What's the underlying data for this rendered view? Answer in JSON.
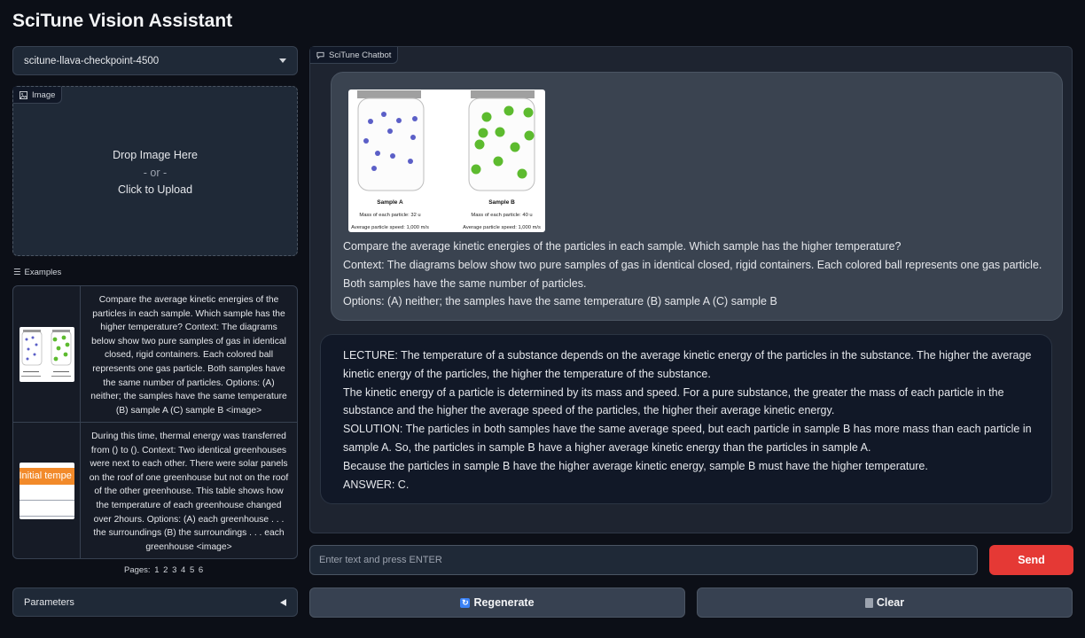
{
  "app": {
    "title": "SciTune Vision Assistant"
  },
  "model_select": {
    "value": "scitune-llava-checkpoint-4500",
    "icon": "chevron-down-icon"
  },
  "image_upload": {
    "label": "Image",
    "drop_text": "Drop Image Here",
    "or_text": "- or -",
    "click_text": "Click to Upload"
  },
  "examples": {
    "label": "Examples",
    "rows": [
      {
        "text": "Compare the average kinetic energies of the particles in each sample. Which sample has the higher temperature? Context: The diagrams below show two pure samples of gas in identical closed, rigid containers. Each colored ball represents one gas particle. Both samples have the same number of particles. Options: (A) neither; the samples have the same temperature (B) sample A (C) sample B <image>"
      },
      {
        "text": "During this time, thermal energy was transferred from () to (). Context: Two identical greenhouses were next to each other. There were solar panels on the roof of one greenhouse but not on the roof of the other greenhouse. This table shows how the temperature of each greenhouse changed over 2hours. Options: (A) each greenhouse . . . the surroundings (B) the surroundings . . . each greenhouse <image>",
        "thumb_text": "Initial tempe"
      }
    ],
    "pages_label": "Pages:",
    "pages": [
      "1",
      "2",
      "3",
      "4",
      "5",
      "6"
    ]
  },
  "parameters": {
    "label": "Parameters"
  },
  "chatbot": {
    "label": "SciTune Chatbot",
    "image": {
      "sample_a": {
        "title": "Sample A",
        "mass": "Mass of each particle: 32 u",
        "speed": "Average particle speed: 1,000 m/s"
      },
      "sample_b": {
        "title": "Sample B",
        "mass": "Mass of each particle: 40 u",
        "speed": "Average particle speed: 1,000 m/s"
      }
    },
    "user_lines": [
      "Compare the average kinetic energies of the particles in each sample. Which sample has the higher temperature?",
      "Context: The diagrams below show two pure samples of gas in identical closed, rigid containers. Each colored ball represents one gas particle. Both samples have the same number of particles.",
      "Options: (A) neither; the samples have the same temperature (B) sample A (C) sample B"
    ],
    "bot_lines": [
      "LECTURE: The temperature of a substance depends on the average kinetic energy of the particles in the substance. The higher the average kinetic energy of the particles, the higher the temperature of the substance.",
      "The kinetic energy of a particle is determined by its mass and speed. For a pure substance, the greater the mass of each particle in the substance and the higher the average speed of the particles, the higher their average kinetic energy.",
      "SOLUTION: The particles in both samples have the same average speed, but each particle in sample B has more mass than each particle in sample A. So, the particles in sample B have a higher average kinetic energy than the particles in sample A.",
      "Because the particles in sample B have the higher average kinetic energy, sample B must have the higher temperature.",
      "ANSWER: C."
    ]
  },
  "input": {
    "placeholder": "Enter text and press ENTER"
  },
  "buttons": {
    "send": "Send",
    "regenerate": "Regenerate",
    "clear": "Clear"
  },
  "colors": {
    "send": "#e53935",
    "particle_a": "#5b5fc7",
    "particle_b": "#5dbb2f",
    "thumb_band": "#f28a2a"
  }
}
